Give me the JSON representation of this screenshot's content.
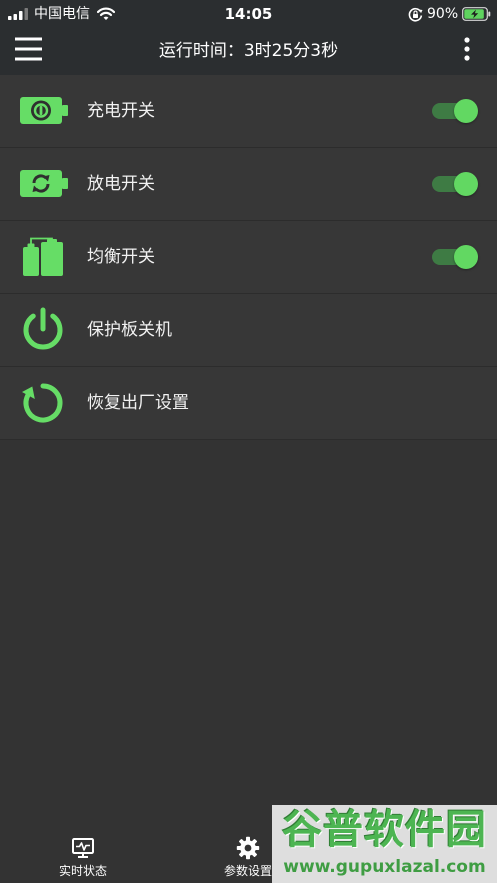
{
  "status_bar": {
    "carrier": "中国电信",
    "time": "14:05",
    "battery_percent": "90%",
    "icons": [
      "signal-icon",
      "wifi-icon",
      "orientation-lock-icon",
      "battery-charging-icon"
    ]
  },
  "header": {
    "title": "运行时间：3时25分3秒",
    "menu_icon": "hamburger-menu-icon",
    "more_icon": "more-vertical-icon"
  },
  "list": {
    "items": [
      {
        "label": "充电开关",
        "icon": "battery-charge-icon",
        "toggle_on": true
      },
      {
        "label": "放电开关",
        "icon": "battery-discharge-icon",
        "toggle_on": true
      },
      {
        "label": "均衡开关",
        "icon": "cell-balance-icon",
        "toggle_on": true
      },
      {
        "label": "保护板关机",
        "icon": "power-icon"
      },
      {
        "label": "恢复出厂设置",
        "icon": "factory-reset-icon"
      }
    ]
  },
  "tab_bar": {
    "tabs": [
      {
        "label": "实时状态",
        "icon": "monitor-icon"
      },
      {
        "label": "参数设置",
        "icon": "gear-icon"
      }
    ]
  },
  "watermark": {
    "title": "谷普软件园",
    "url": "www.gupuxlazal.com"
  },
  "colors": {
    "accent": "#66dd66",
    "toggle_track": "#3e7b44",
    "toggle_knob": "#62d862",
    "header_bg": "#2b2e30",
    "row_bg": "#373737",
    "page_bg": "#333333"
  }
}
